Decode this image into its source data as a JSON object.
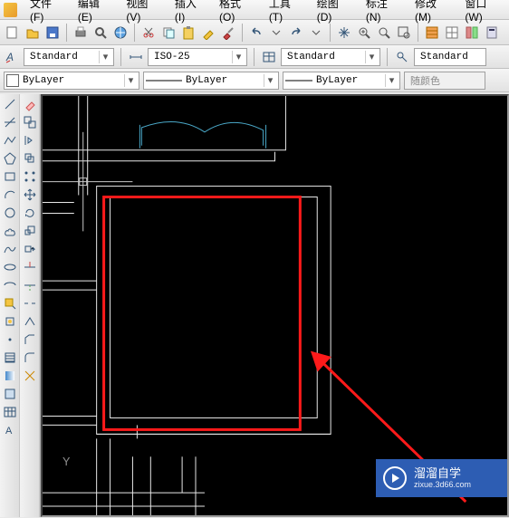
{
  "menu": {
    "items": [
      "文件(F)",
      "编辑(E)",
      "视图(V)",
      "插入(I)",
      "格式(O)",
      "工具(T)",
      "绘图(D)",
      "标注(N)",
      "修改(M)",
      "窗口(W)"
    ]
  },
  "toolbar_icons": {
    "new": "new",
    "open": "open",
    "save": "save",
    "print": "print",
    "preview": "preview",
    "publish": "publish",
    "cut": "cut",
    "copy": "copy",
    "paste": "paste",
    "match": "match",
    "brush": "brush",
    "undo": "undo",
    "redo": "redo",
    "pan": "pan",
    "zoom_in": "zoom-in",
    "zoom_ext": "zoom-ext",
    "zoom_win": "zoom-win",
    "grid1": "grid1",
    "grid2": "grid2",
    "help": "help",
    "palette": "palette"
  },
  "styles": {
    "text_style": "Standard",
    "dim_style": "ISO-25",
    "table_style": "Standard",
    "ml_style": "Standard"
  },
  "layers": {
    "layer": "ByLayer",
    "linetype": "ByLayer",
    "lineweight": "ByLayer",
    "color_label": "随颜色"
  },
  "canvas": {
    "axis_y": "Y"
  },
  "watermark": {
    "title": "溜溜自学",
    "sub": "zixue.3d66.com"
  }
}
